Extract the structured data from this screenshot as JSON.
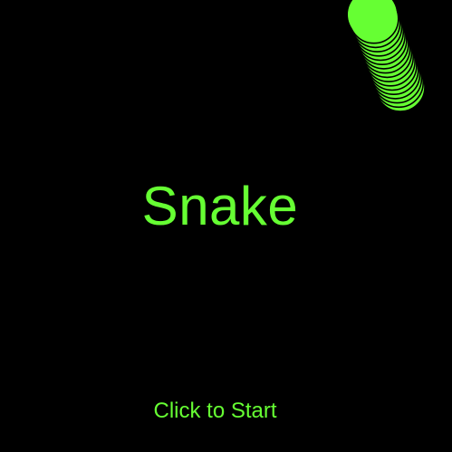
{
  "game": {
    "title": "Snake",
    "start_prompt": "Click to Start"
  },
  "colors": {
    "background": "#000000",
    "snake": "#66ff33",
    "text": "#66ff33"
  }
}
